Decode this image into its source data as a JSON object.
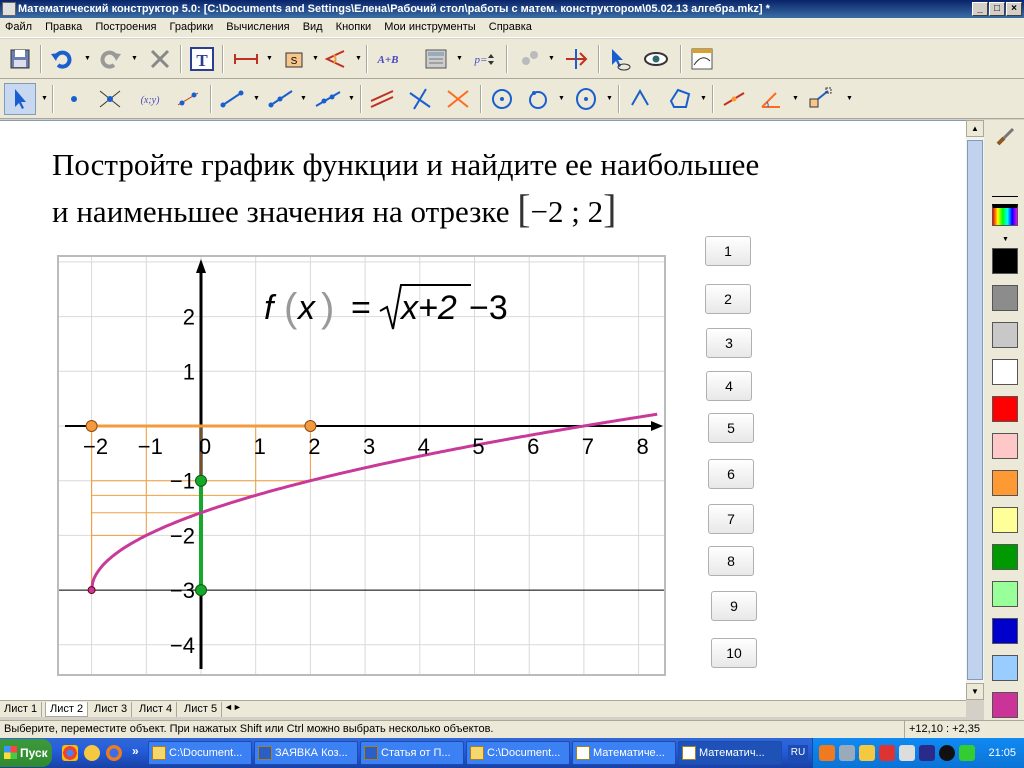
{
  "window": {
    "title": "Математический конструктор 5.0: [C:\\Documents and Settings\\Елена\\Рабочий стол\\работы с матем. конструктором\\05.02.13 алгебра.mkz] *",
    "min": "_",
    "max": "□",
    "close": "×"
  },
  "menu": [
    "Файл",
    "Правка",
    "Построения",
    "Графики",
    "Вычисления",
    "Вид",
    "Кнопки",
    "Мои инструменты",
    "Справка"
  ],
  "problem": {
    "line1": "Постройте график функции и найдите ее наибольшее",
    "line2": "и наименьшее значения на отрезке",
    "interval": "−2 ; 2"
  },
  "graph": {
    "formula": {
      "f": "f",
      "x": "x",
      "eq": "=",
      "radicand": "x+2",
      "tail": "−3"
    },
    "x_ticks": [
      "−2",
      "−1",
      "0",
      "1",
      "2",
      "3",
      "4",
      "5",
      "6",
      "7",
      "8"
    ],
    "y_ticks": [
      "2",
      "1",
      "−1",
      "−2",
      "−3",
      "−4"
    ],
    "xlim": [
      -2,
      8
    ],
    "ylim": [
      -4,
      2
    ],
    "function": "sqrt(x+2)-3",
    "colors": {
      "curve": "#c8399a",
      "segment": "#f39a3e",
      "range": "#16a82a",
      "helper": "#f0a040"
    }
  },
  "answer_buttons": [
    "1",
    "2",
    "3",
    "4",
    "5",
    "6",
    "7",
    "8",
    "9",
    "10"
  ],
  "palette": [
    "#000000",
    "#8c8c8c",
    "#c8c8c8",
    "#ffffff",
    "#ff0000",
    "#ffc8c8",
    "#ff9933",
    "#ffff99",
    "#009900",
    "#99ff99",
    "#0000cc",
    "#99ccff",
    "#cc3399"
  ],
  "sheet_tabs": [
    "Лист 1",
    "Лист 2",
    "Лист 3",
    "Лист 4",
    "Лист 5"
  ],
  "status": {
    "message": "Выберите, переместите объект. При нажатых Shift или Ctrl можно выбрать несколько объектов.",
    "coords": "+12,10 : +2,35"
  },
  "taskbar": {
    "start": "Пуск",
    "chevron": "»",
    "lang": "RU",
    "clock": "21:05",
    "tasks": [
      "C:\\Document...",
      "ЗАЯВКА Коз...",
      "Статья от П...",
      "C:\\Document...",
      "Математиче...",
      "Математич..."
    ]
  }
}
